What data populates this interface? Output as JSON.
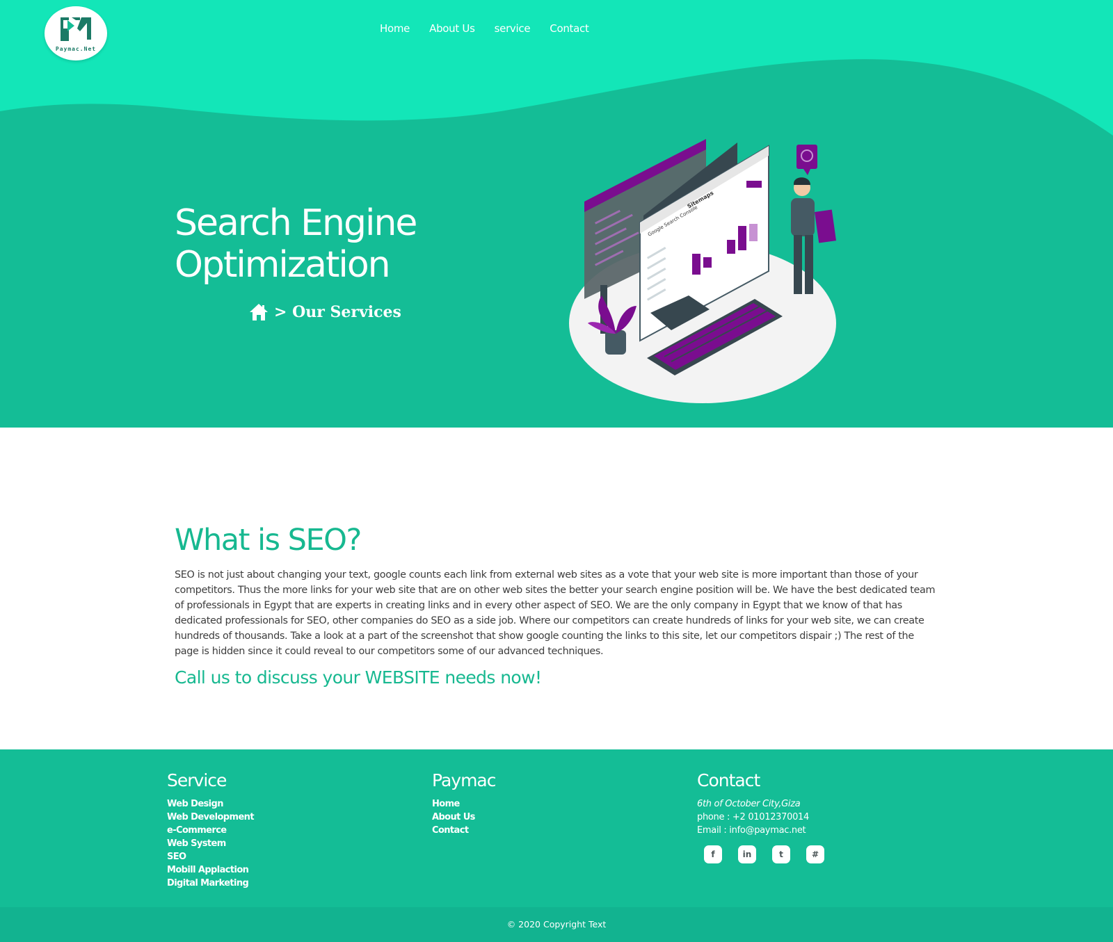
{
  "brand": {
    "logo_text": "Paymac.Net"
  },
  "nav": {
    "items": [
      "Home",
      "About Us",
      "service",
      "Contact"
    ]
  },
  "hero": {
    "title_line1": "Search Engine",
    "title_line2": "Optimization",
    "breadcrumb": "> Our Services",
    "illustration_labels": {
      "console": "Google Search Console",
      "sitemaps": "Sitemaps"
    }
  },
  "content": {
    "heading": "What is SEO?",
    "body": "SEO is not just about changing your text, google counts each link from external web sites as a vote that your web site is more important than those of your competitors. Thus the more links for your web site that are on other web sites the better your search engine position will be. We have the best dedicated team of professionals in Egypt that are experts in creating links and in every other aspect of SEO. We are the only company in Egypt that we know of that has dedicated professionals for SEO, other companies do SEO as a side job. Where our competitors can create hundreds of links for your web site, we can create hundreds of thousands. Take a look at a part of the screenshot that show google counting the links to this site, let our competitors dispair ;) The rest of the page is hidden since it could reveal to our competitors some of our advanced techniques.",
    "cta": "Call us to discuss your WEBSITE needs now!"
  },
  "footer": {
    "service": {
      "title": "Service",
      "items": [
        "Web Design",
        "Web Development",
        "e-Commerce",
        "Web System",
        "SEO",
        "Mobill Applaction",
        "Digital Marketing"
      ]
    },
    "paymac": {
      "title": "Paymac",
      "items": [
        "Home",
        "About Us",
        "Contact"
      ]
    },
    "contact": {
      "title": "Contact",
      "address": "6th of October City,Giza",
      "phone": "phone : +2 01012370014",
      "email": "Email : info@paymac.net"
    },
    "socials": [
      {
        "icon": "facebook-icon",
        "glyph": "f"
      },
      {
        "icon": "linkedin-icon",
        "glyph": "in"
      },
      {
        "icon": "twitter-icon",
        "glyph": "t"
      },
      {
        "icon": "slack-icon",
        "glyph": "#"
      }
    ],
    "copyright": "© 2020 Copyright Text"
  },
  "colors": {
    "primary": "#14bd96",
    "wave_light": "#13e6b8",
    "accent_text": "#17b890",
    "illustration_purple": "#7a0d8f"
  }
}
